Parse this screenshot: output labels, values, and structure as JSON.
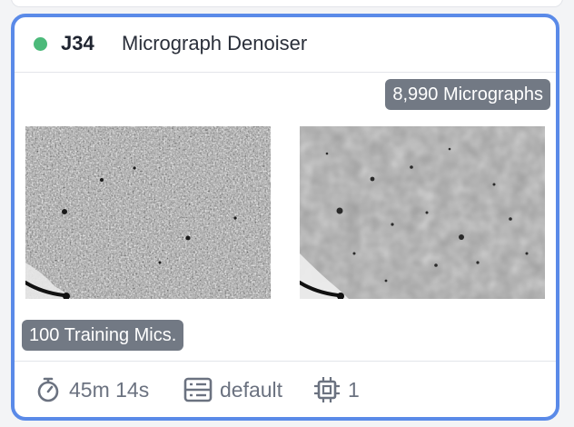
{
  "card": {
    "status_color": "#4cba7a",
    "border_color": "#5a8ae8",
    "job_id": "J34",
    "job_title": "Micrograph Denoiser",
    "micrograph_count_badge": "8,990 Micrographs",
    "training_badge": "100 Training Mics.",
    "images": [
      {
        "name": "raw-micrograph",
        "style": "noisy"
      },
      {
        "name": "denoised-micrograph",
        "style": "denoised"
      }
    ],
    "footer": {
      "runtime": "45m 14s",
      "runtime_icon": "stopwatch-icon",
      "lane": "default",
      "lane_icon": "server-lane-icon",
      "gpus": "1",
      "gpus_icon": "gpu-chip-icon"
    }
  }
}
